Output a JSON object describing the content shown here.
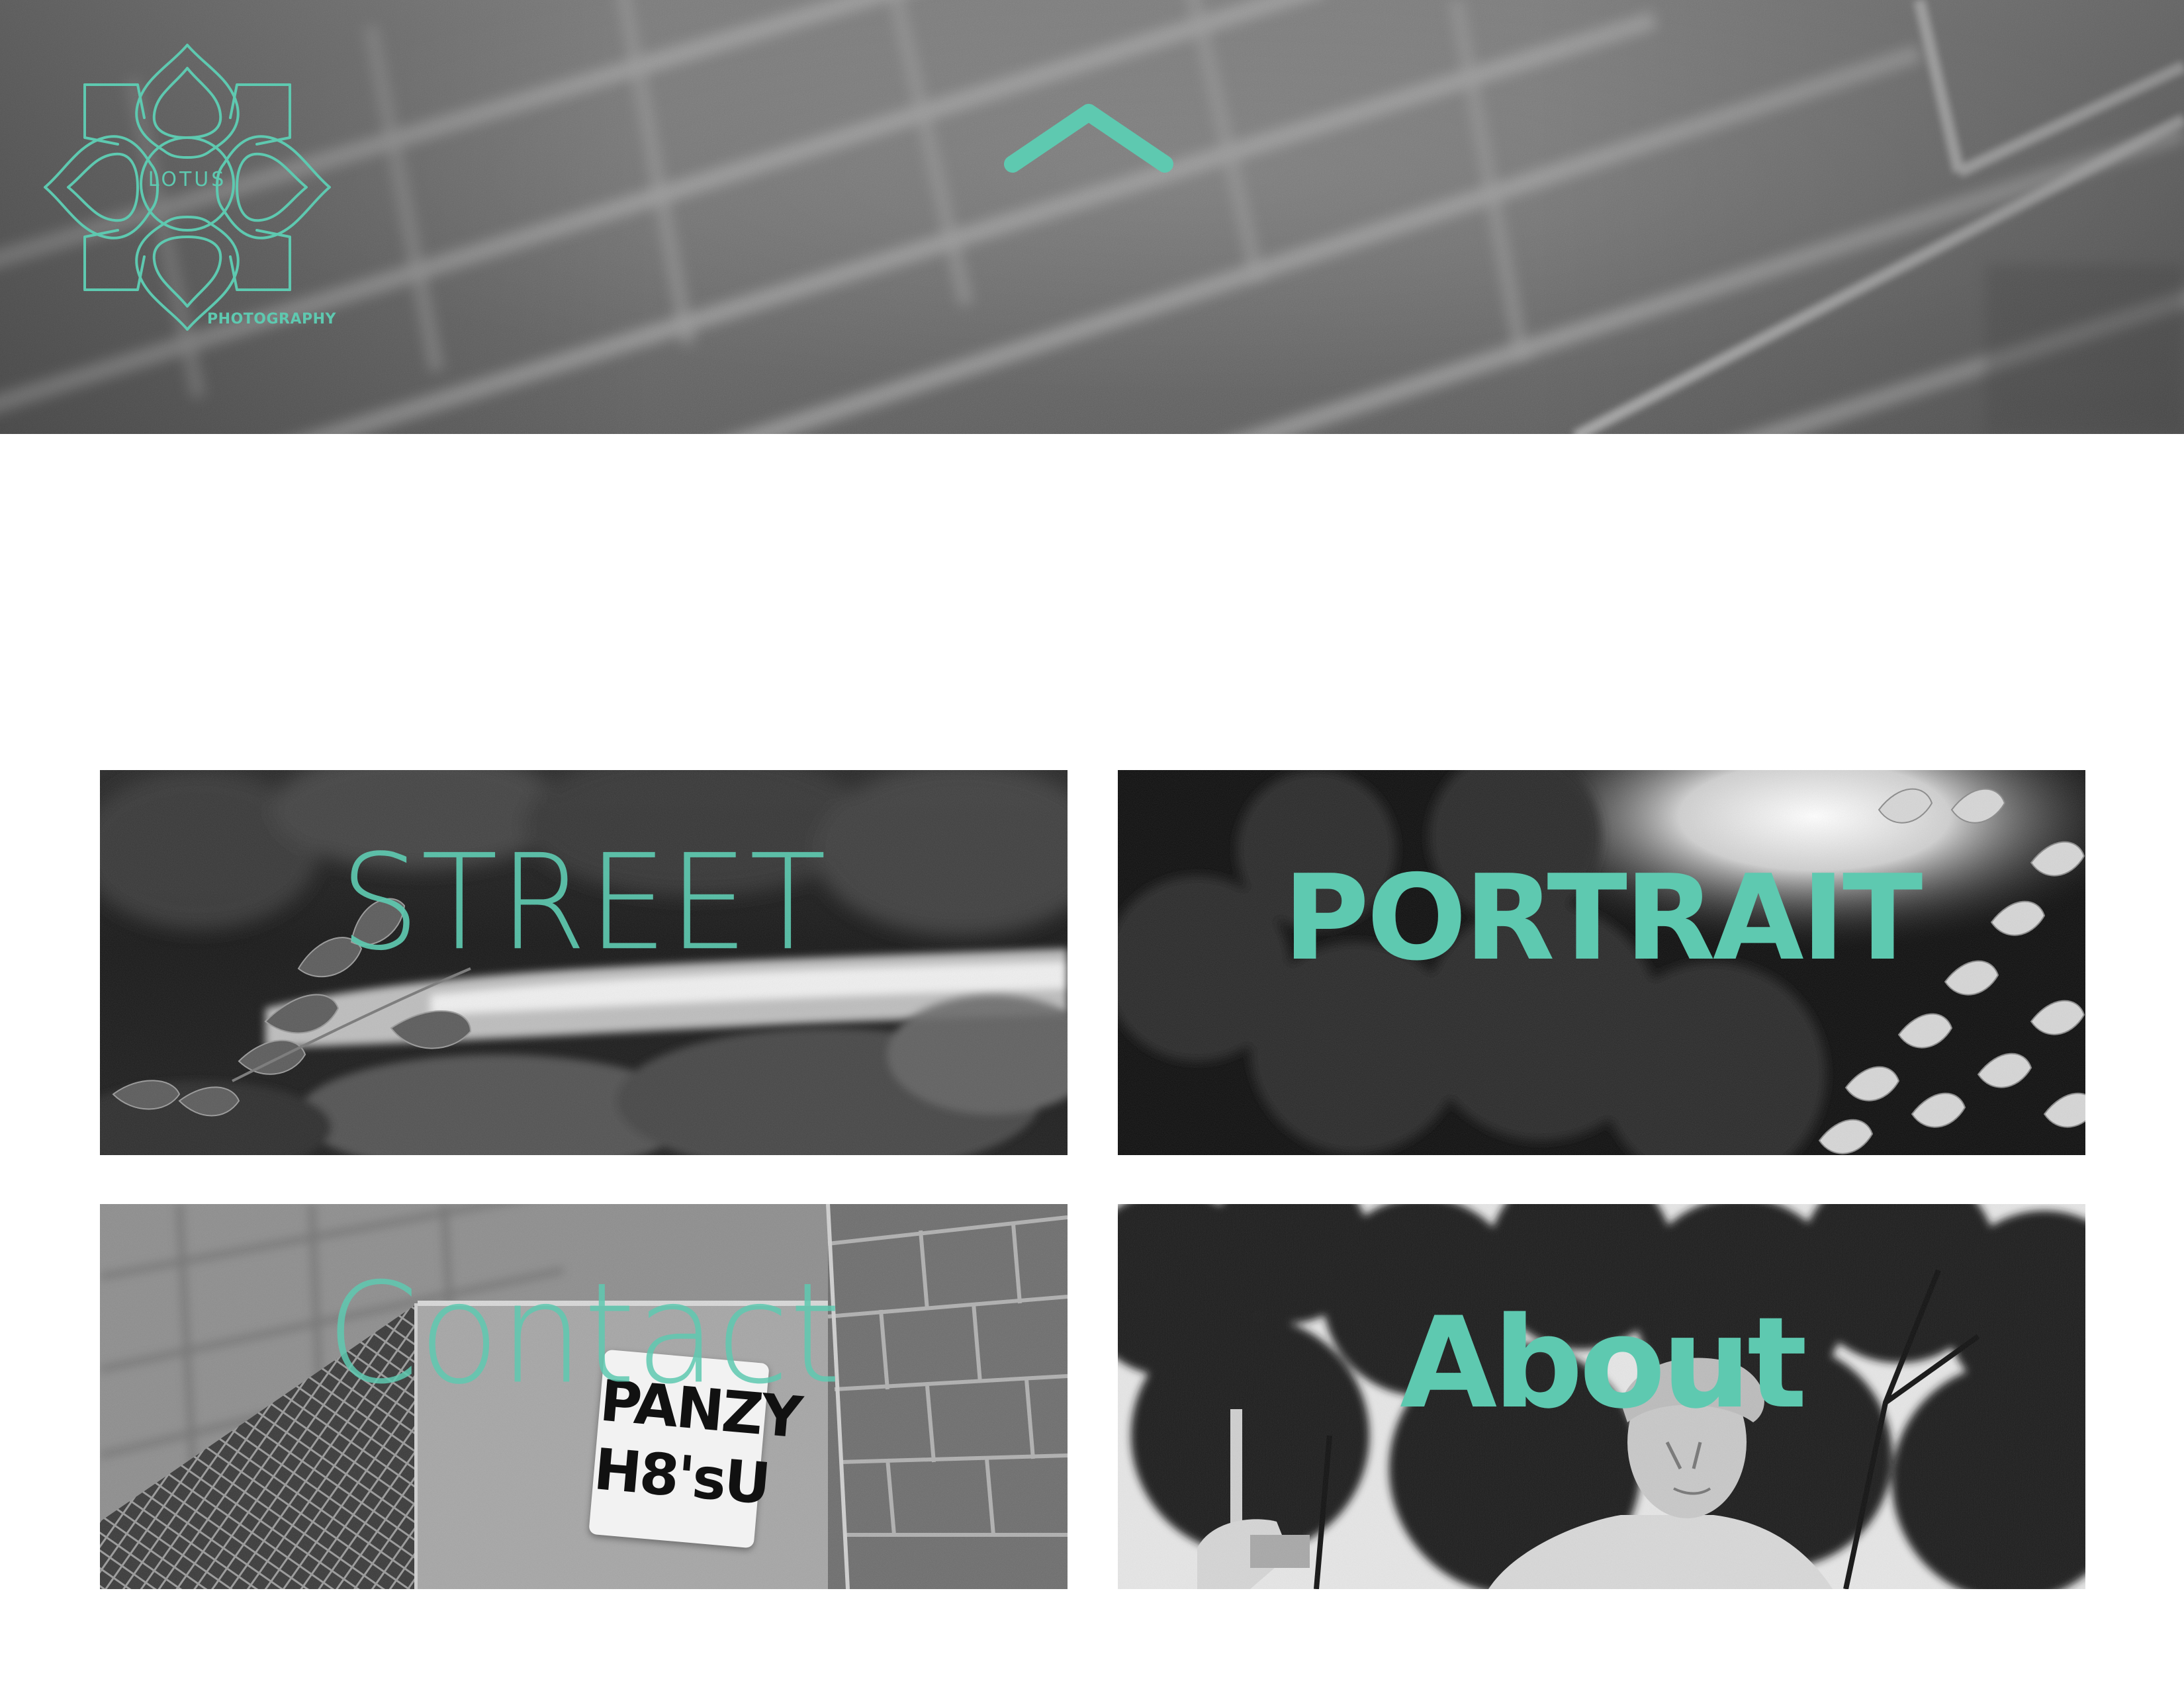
{
  "brand": {
    "name": "LOTUS",
    "tagline": "PHOTOGRAPHY",
    "accent_color": "#5ec9b0"
  },
  "nav": {
    "scroll_up_icon": "chevron-up-icon"
  },
  "tiles": [
    {
      "label": "STREET",
      "photo": "foliage-and-river"
    },
    {
      "label": "PORTRAIT",
      "photo": "tree-canopy"
    },
    {
      "label": "Contact",
      "photo": "brick-wall-with-sticker",
      "sticker_text": "PANZY H8'sU"
    },
    {
      "label": "About",
      "photo": "statue-under-trees"
    }
  ]
}
